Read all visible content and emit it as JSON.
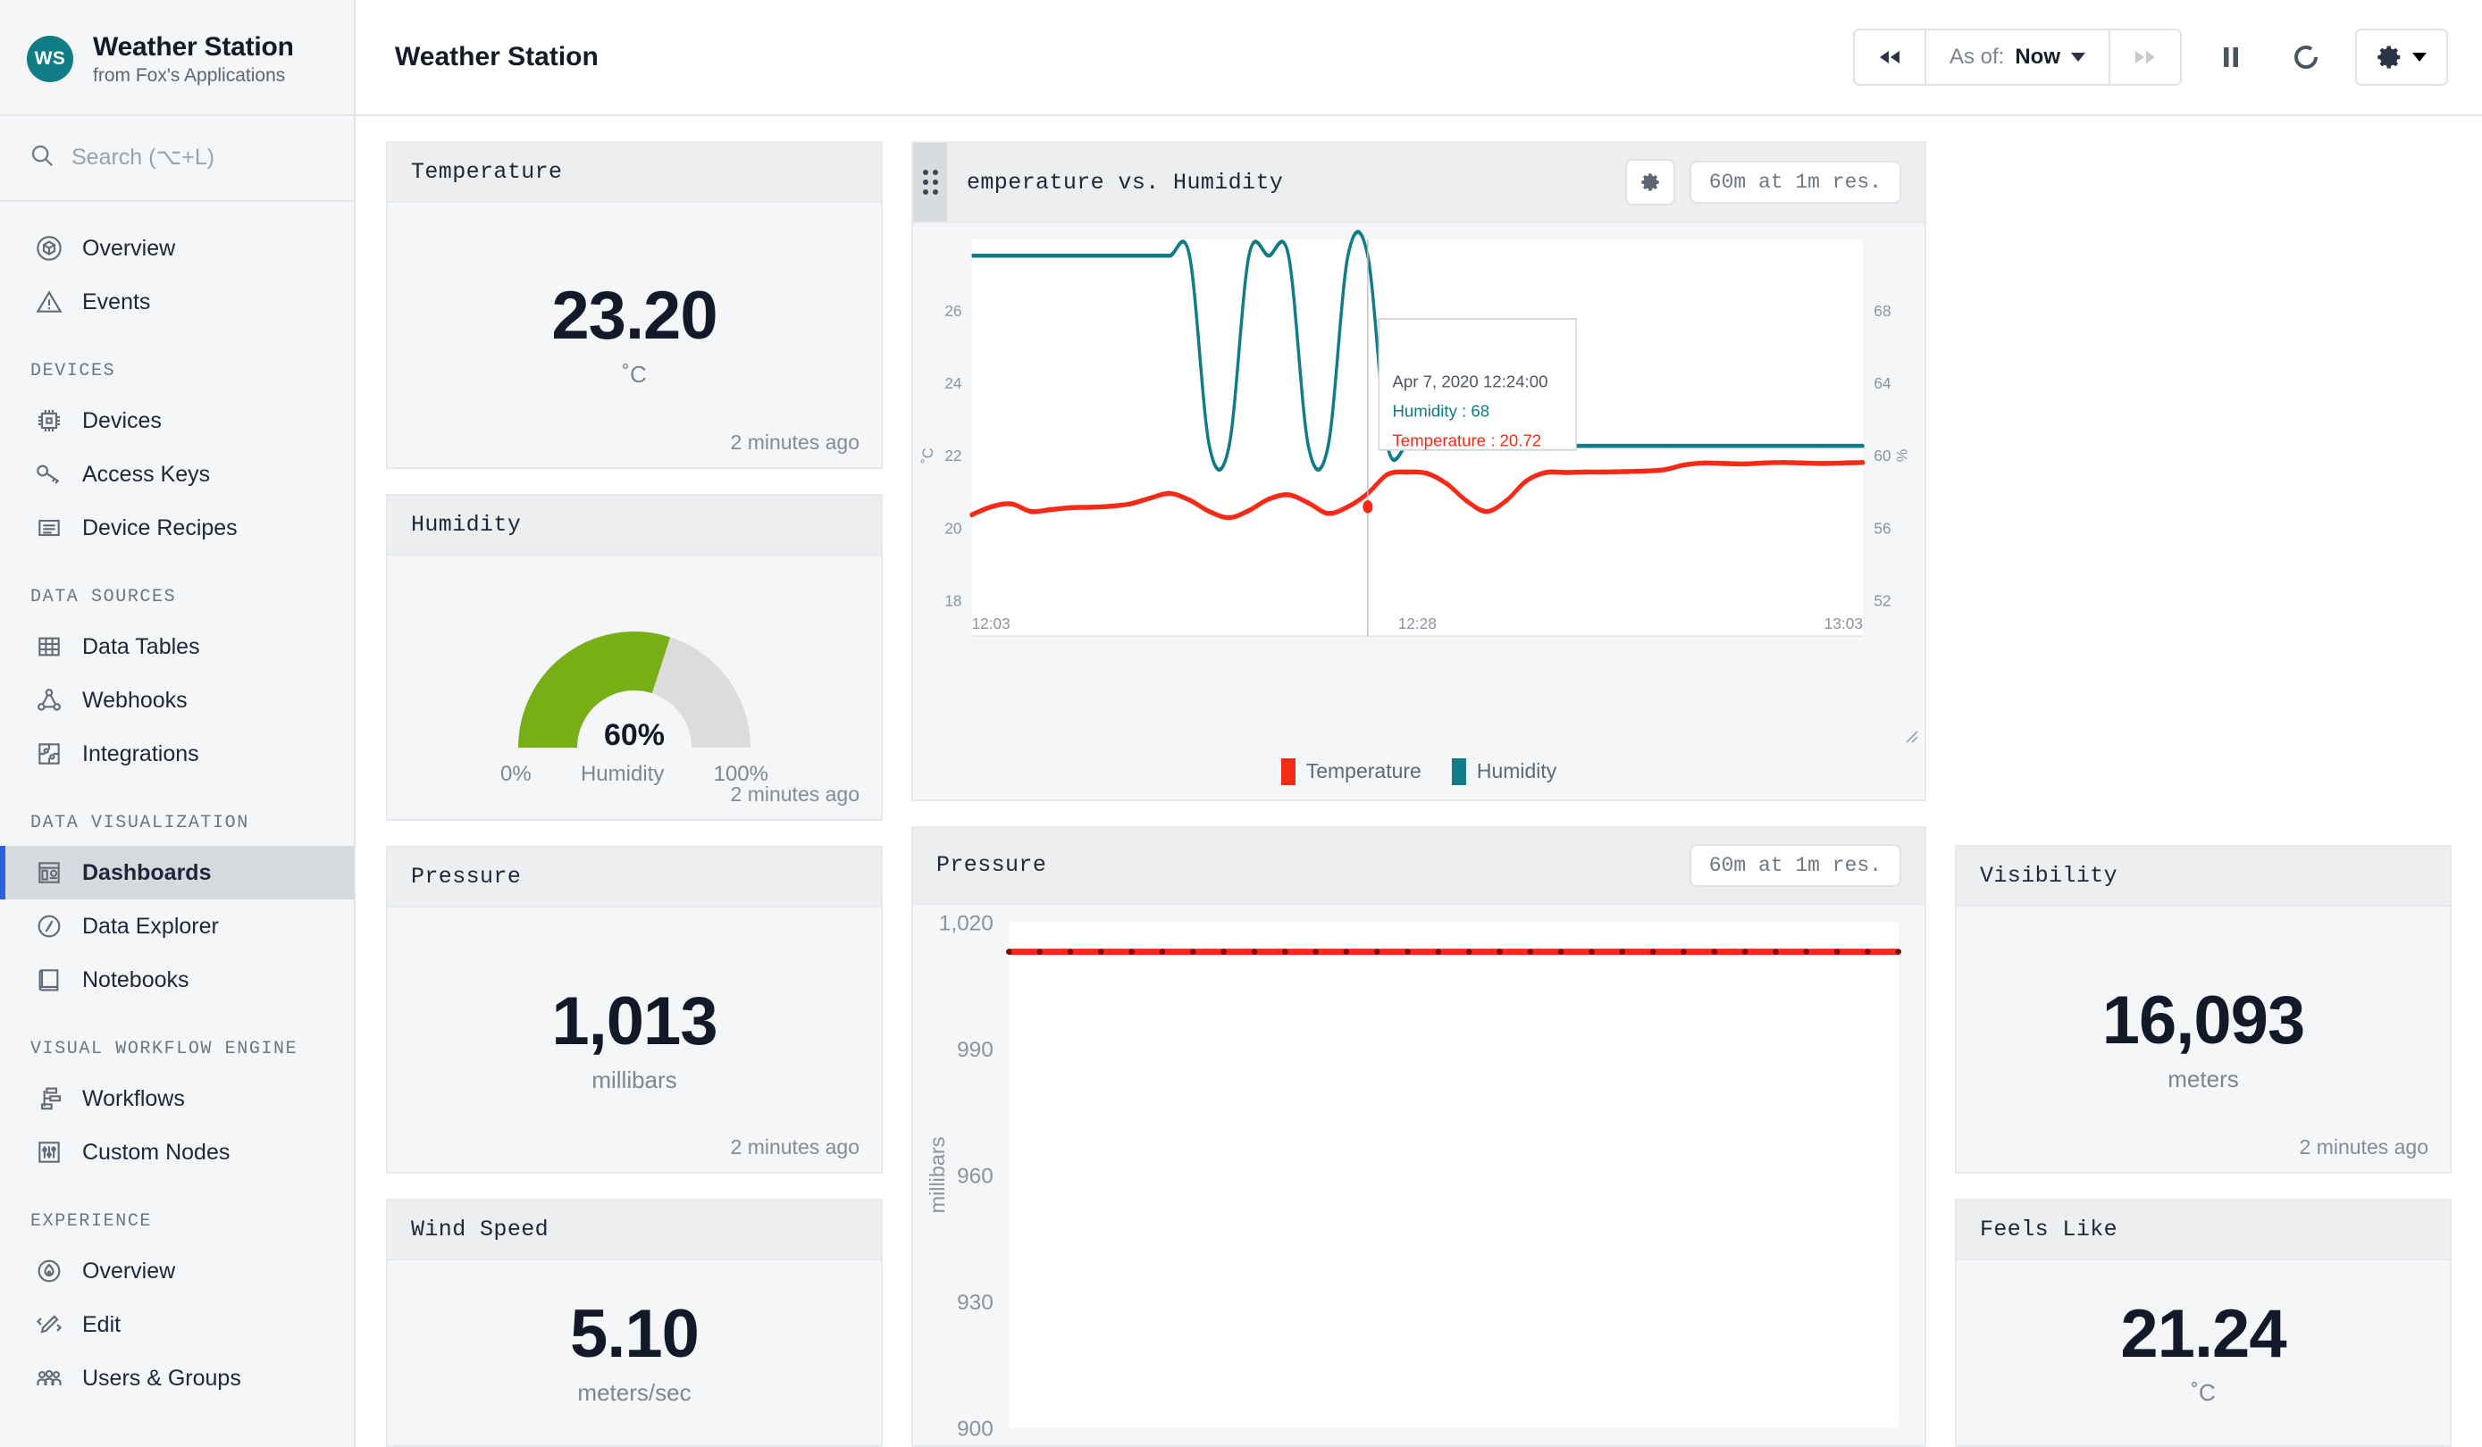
{
  "sidebar": {
    "brand": {
      "badge": "WS",
      "title": "Weather Station",
      "subtitle": "from Fox's Applications"
    },
    "search": {
      "placeholder": "Search (⌥+L)"
    },
    "top_items": [
      {
        "label": "Overview",
        "icon": "cube-outline-icon"
      },
      {
        "label": "Events",
        "icon": "warning-triangle-icon"
      }
    ],
    "groups": [
      {
        "title": "DEVICES",
        "items": [
          {
            "label": "Devices",
            "icon": "chip-icon"
          },
          {
            "label": "Access Keys",
            "icon": "key-icon"
          },
          {
            "label": "Device Recipes",
            "icon": "recipe-document-icon"
          }
        ]
      },
      {
        "title": "DATA SOURCES",
        "items": [
          {
            "label": "Data Tables",
            "icon": "table-grid-icon"
          },
          {
            "label": "Webhooks",
            "icon": "webhook-icon"
          },
          {
            "label": "Integrations",
            "icon": "puzzle-icon"
          }
        ]
      },
      {
        "title": "DATA VISUALIZATION",
        "items": [
          {
            "label": "Dashboards",
            "icon": "dashboard-icon",
            "active": true
          },
          {
            "label": "Data Explorer",
            "icon": "compass-icon"
          },
          {
            "label": "Notebooks",
            "icon": "book-icon"
          }
        ]
      },
      {
        "title": "VISUAL WORKFLOW ENGINE",
        "items": [
          {
            "label": "Workflows",
            "icon": "workflow-icon"
          },
          {
            "label": "Custom Nodes",
            "icon": "sliders-icon"
          }
        ]
      },
      {
        "title": "EXPERIENCE",
        "items": [
          {
            "label": "Overview",
            "icon": "flame-circle-icon"
          },
          {
            "label": "Edit",
            "icon": "code-pencil-icon"
          },
          {
            "label": "Users & Groups",
            "icon": "users-icon"
          }
        ]
      }
    ]
  },
  "topbar": {
    "title": "Weather Station",
    "rewind_label": "◀◀",
    "asof_prefix": "As of:",
    "asof_value": "Now",
    "forward_label": "▶▶",
    "pause_label": "‖",
    "refresh_label": "refresh-icon",
    "gear_label": "gear-icon"
  },
  "cards": {
    "temperature": {
      "title": "Temperature",
      "value": "23.20",
      "unit": "˚C",
      "ago": "2 minutes ago"
    },
    "humidity": {
      "title": "Humidity",
      "value": "60%",
      "percent": 60,
      "min_label": "0%",
      "max_label": "100%",
      "center_label": "Humidity",
      "ago": "2 minutes ago",
      "arc_color": "#79af16",
      "track_color": "#dcdcdc"
    },
    "pressure": {
      "title": "Pressure",
      "value": "1,013",
      "unit": "millibars",
      "ago": "2 minutes ago"
    },
    "wind_speed": {
      "title": "Wind Speed",
      "value": "5.10",
      "unit": "meters/sec"
    },
    "visibility": {
      "title": "Visibility",
      "value": "16,093",
      "unit": "meters",
      "ago": "2 minutes ago"
    },
    "feels_like": {
      "title": "Feels Like",
      "value": "21.24",
      "unit": "˚C"
    }
  },
  "temp_hum_panel": {
    "title": "emperature vs. Humidity",
    "resolution": "60m at 1m res.",
    "gear": "gear-icon",
    "tooltip": {
      "timestamp": "Apr 7, 2020 12:24:00",
      "humidity_label": "Humidity : 68",
      "temperature_label": "Temperature : 20.72"
    }
  },
  "pressure_panel": {
    "title": "Pressure",
    "resolution": "60m at 1m res."
  },
  "chart_data": [
    {
      "type": "line",
      "title": "emperature vs. Humidity",
      "xlabel": "",
      "x_ticks": [
        "12:03",
        "12:28",
        "13:03"
      ],
      "ylabel": "˚C",
      "ylim": [
        18,
        26
      ],
      "y_ticks": [
        18,
        20,
        22,
        24,
        26
      ],
      "y2label": "%",
      "y2lim": [
        52,
        68
      ],
      "y2_ticks": [
        52,
        56,
        60,
        64,
        68
      ],
      "grid": false,
      "legend": "bottom",
      "series": [
        {
          "name": "Temperature",
          "color": "#f52b18",
          "axis": "left",
          "values": [
            20.55,
            20.72,
            20.78,
            20.62,
            20.66,
            20.7,
            20.71,
            20.73,
            20.78,
            20.9,
            21.0,
            20.86,
            20.62,
            20.49,
            20.64,
            20.88,
            20.97,
            20.8,
            20.58,
            20.72,
            21.0,
            21.4,
            21.45,
            21.42,
            21.2,
            20.84,
            20.62,
            20.85,
            21.26,
            21.44,
            21.44,
            21.45,
            21.45,
            21.46,
            21.47,
            21.5,
            21.6,
            21.64,
            21.63,
            21.62,
            21.64,
            21.65,
            21.64,
            21.63,
            21.64,
            21.65
          ]
        },
        {
          "name": "Humidity",
          "color": "#0f7c86",
          "axis": "right",
          "values": [
            68,
            68,
            68,
            68,
            68,
            68,
            68,
            68,
            68,
            68,
            68,
            68,
            60,
            60,
            68,
            68,
            68,
            60,
            60,
            68,
            68,
            60,
            60,
            60,
            60,
            60,
            60,
            60,
            60,
            60,
            60,
            60,
            60,
            60,
            60,
            60,
            60,
            60,
            60,
            60,
            60,
            60,
            60,
            60,
            60,
            60
          ]
        }
      ],
      "annotation": {
        "x_index": 20,
        "timestamp": "Apr 7, 2020 12:24:00",
        "humidity": 68,
        "temperature": 20.72
      }
    },
    {
      "type": "line",
      "title": "Pressure",
      "xlabel": "",
      "ylabel": "millibars",
      "ylim": [
        900,
        1020
      ],
      "y_ticks": [
        900,
        930,
        960,
        990,
        1020
      ],
      "grid": false,
      "series": [
        {
          "name": "Pressure",
          "color": "#f52b18",
          "values": [
            1013,
            1013,
            1013,
            1013,
            1013,
            1013,
            1013,
            1013,
            1013,
            1013,
            1013,
            1013,
            1013,
            1013,
            1013,
            1013,
            1013,
            1013,
            1013,
            1013,
            1013,
            1013,
            1013,
            1013,
            1013,
            1013,
            1013,
            1013,
            1013,
            1013
          ]
        }
      ]
    }
  ]
}
